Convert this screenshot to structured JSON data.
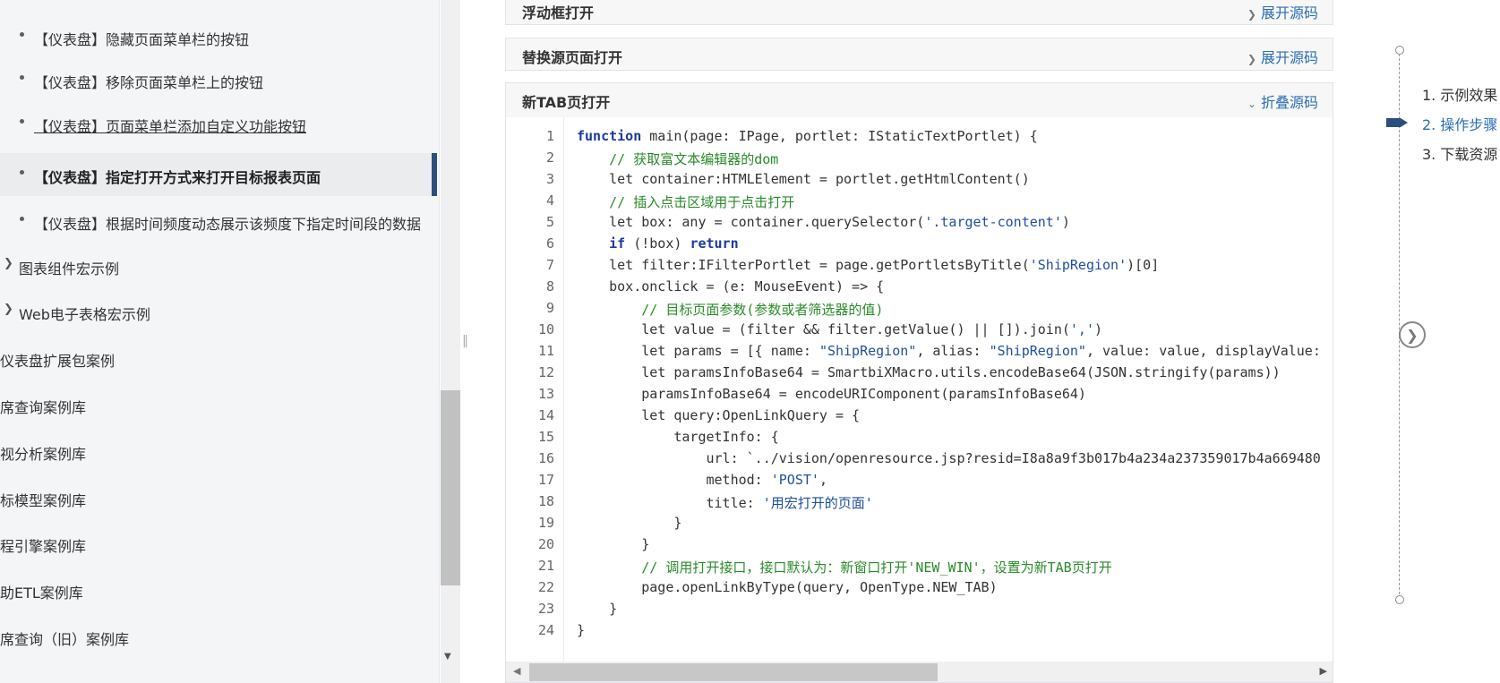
{
  "sidebar": {
    "items": [
      {
        "label": "【仪表盘】隐藏页面菜单栏的按钮"
      },
      {
        "label": "【仪表盘】移除页面菜单栏上的按钮"
      },
      {
        "label": "【仪表盘】页面菜单栏添加自定义功能按钮"
      },
      {
        "label": "【仪表盘】指定打开方式来打开目标报表页面"
      },
      {
        "label": "【仪表盘】根据时间频度动态展示该频度下指定时间段的数据"
      }
    ],
    "groups": [
      {
        "label": "图表组件宏示例"
      },
      {
        "label": "Web电子表格宏示例"
      }
    ],
    "categories": [
      {
        "label": "仪表盘扩展包案例"
      },
      {
        "label": "席查询案例库"
      },
      {
        "label": "视分析案例库"
      },
      {
        "label": "标模型案例库"
      },
      {
        "label": "程引擎案例库"
      },
      {
        "label": "助ETL案例库"
      },
      {
        "label": "席查询（旧）案例库"
      }
    ]
  },
  "panels": [
    {
      "title": "浮动框打开",
      "action": "展开源码"
    },
    {
      "title": "替换源页面打开",
      "action": "展开源码"
    },
    {
      "title": "新TAB页打开",
      "action": "折叠源码"
    }
  ],
  "code": {
    "lines": [
      {
        "n": "1",
        "segs": [
          {
            "t": "function",
            "c": "kw"
          },
          {
            "t": " main(page: IPage, portlet: IStaticTextPortlet) {",
            "c": ""
          }
        ]
      },
      {
        "n": "2",
        "segs": [
          {
            "t": "    ",
            "c": ""
          },
          {
            "t": "// 获取富文本编辑器的dom",
            "c": "cm"
          }
        ]
      },
      {
        "n": "3",
        "segs": [
          {
            "t": "    let container:HTMLElement = portlet.getHtmlContent()",
            "c": ""
          }
        ]
      },
      {
        "n": "4",
        "segs": [
          {
            "t": "    ",
            "c": ""
          },
          {
            "t": "// 插入点击区域用于点击打开",
            "c": "cm"
          }
        ]
      },
      {
        "n": "5",
        "segs": [
          {
            "t": "    let box: any = container.querySelector(",
            "c": ""
          },
          {
            "t": "'.target-content'",
            "c": "st"
          },
          {
            "t": ")",
            "c": ""
          }
        ]
      },
      {
        "n": "6",
        "segs": [
          {
            "t": "    ",
            "c": ""
          },
          {
            "t": "if",
            "c": "kw"
          },
          {
            "t": " (!box) ",
            "c": ""
          },
          {
            "t": "return",
            "c": "kw"
          }
        ]
      },
      {
        "n": "7",
        "segs": [
          {
            "t": "    let filter:IFilterPortlet = page.getPortletsByTitle(",
            "c": ""
          },
          {
            "t": "'ShipRegion'",
            "c": "st"
          },
          {
            "t": ")[0]",
            "c": ""
          }
        ]
      },
      {
        "n": "8",
        "segs": [
          {
            "t": "    box.onclick = (e: MouseEvent) => {",
            "c": ""
          }
        ]
      },
      {
        "n": "9",
        "segs": [
          {
            "t": "        ",
            "c": ""
          },
          {
            "t": "// 目标页面参数(参数或者筛选器的值)",
            "c": "cm"
          }
        ]
      },
      {
        "n": "10",
        "segs": [
          {
            "t": "        let value = (filter && filter.getValue() || []).join(",
            "c": ""
          },
          {
            "t": "','",
            "c": "st"
          },
          {
            "t": ")",
            "c": ""
          }
        ]
      },
      {
        "n": "11",
        "segs": [
          {
            "t": "        let params = [{ name: ",
            "c": ""
          },
          {
            "t": "\"ShipRegion\"",
            "c": "st"
          },
          {
            "t": ", alias: ",
            "c": ""
          },
          {
            "t": "\"ShipRegion\"",
            "c": "st"
          },
          {
            "t": ", value: value, displayValue:",
            "c": ""
          }
        ]
      },
      {
        "n": "12",
        "segs": [
          {
            "t": "        let paramsInfoBase64 = SmartbiXMacro.utils.encodeBase64(JSON.stringify(params))",
            "c": ""
          }
        ]
      },
      {
        "n": "13",
        "segs": [
          {
            "t": "        paramsInfoBase64 = encodeURIComponent(paramsInfoBase64)",
            "c": ""
          }
        ]
      },
      {
        "n": "14",
        "segs": [
          {
            "t": "        let query:OpenLinkQuery = {",
            "c": ""
          }
        ]
      },
      {
        "n": "15",
        "segs": [
          {
            "t": "            targetInfo: {",
            "c": ""
          }
        ]
      },
      {
        "n": "16",
        "segs": [
          {
            "t": "                url: `../vision/openresource.jsp?resid=I8a8a9f3b017b4a234a237359017b4a669480",
            "c": ""
          }
        ]
      },
      {
        "n": "17",
        "segs": [
          {
            "t": "                method: ",
            "c": ""
          },
          {
            "t": "'POST'",
            "c": "st"
          },
          {
            "t": ",",
            "c": ""
          }
        ]
      },
      {
        "n": "18",
        "segs": [
          {
            "t": "                title: ",
            "c": ""
          },
          {
            "t": "'用宏打开的页面'",
            "c": "st"
          }
        ]
      },
      {
        "n": "19",
        "segs": [
          {
            "t": "            }",
            "c": ""
          }
        ]
      },
      {
        "n": "20",
        "segs": [
          {
            "t": "        }",
            "c": ""
          }
        ]
      },
      {
        "n": "21",
        "segs": [
          {
            "t": "        ",
            "c": ""
          },
          {
            "t": "// 调用打开接口，接口默认为：新窗口打开'NEW_WIN'，设置为新TAB页打开",
            "c": "cm"
          }
        ]
      },
      {
        "n": "22",
        "segs": [
          {
            "t": "        page.openLinkByType(query, OpenType.NEW_TAB)",
            "c": ""
          }
        ]
      },
      {
        "n": "23",
        "segs": [
          {
            "t": "    }",
            "c": ""
          }
        ]
      },
      {
        "n": "24",
        "segs": [
          {
            "t": "}",
            "c": ""
          }
        ]
      }
    ]
  },
  "outline": {
    "items": [
      {
        "label": "1. 示例效果"
      },
      {
        "label": "2. 操作步骤"
      },
      {
        "label": "3. 下载资源"
      }
    ],
    "active_index": 1
  },
  "colors": {
    "accent": "#2b4d80",
    "link": "#2a6fb3",
    "comment": "#2a8a2a",
    "keyword": "#1a3b9e"
  },
  "icons": {
    "bullet": "bullet-icon",
    "expand": "chevron-right-icon",
    "collapse": "chevron-down-icon",
    "next": "circle-chevron-right-icon"
  }
}
